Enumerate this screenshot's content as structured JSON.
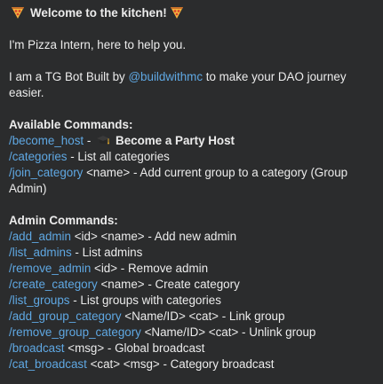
{
  "message": {
    "title": "Welcome to the kitchen!",
    "title_emoji": "pizza-icon",
    "intro": "I'm Pizza Intern, here to help you.",
    "about_prefix": "I am a TG Bot Built by ",
    "about_handle": "@buildwithmc",
    "about_suffix": " to make your DAO journey easier.",
    "available_heading": "Available Commands:",
    "available_commands": [
      {
        "command": "/become_host",
        "sep": " - ",
        "emoji": "graduation-cap-icon",
        "desc": "Become a Party Host",
        "desc_bold": true
      },
      {
        "command": "/categories",
        "desc": " - List all categories"
      },
      {
        "command": "/join_category",
        "desc": " <name> - Add current group to a category (Group Admin)"
      }
    ],
    "admin_heading": "Admin Commands:",
    "admin_commands": [
      {
        "command": "/add_admin",
        "desc": " <id> <name> - Add new admin"
      },
      {
        "command": "/list_admins",
        "desc": " - List admins"
      },
      {
        "command": "/remove_admin",
        "desc": " <id> - Remove admin"
      },
      {
        "command": "/create_category",
        "desc": " <name> - Create category"
      },
      {
        "command": "/list_groups",
        "desc": " - List groups with categories"
      },
      {
        "command": "/add_group_category",
        "desc": " <Name/ID> <cat> - Link group"
      },
      {
        "command": "/remove_group_category",
        "desc": " <Name/ID> <cat> - Unlink group"
      },
      {
        "command": "/broadcast",
        "desc": " <msg> - Global broadcast"
      },
      {
        "command": "/cat_broadcast",
        "desc": " <cat> <msg> - Category broadcast"
      }
    ]
  },
  "colors": {
    "bubble_bg": "#2b2c2d",
    "text": "#ececec",
    "link": "#5fa8e3"
  }
}
